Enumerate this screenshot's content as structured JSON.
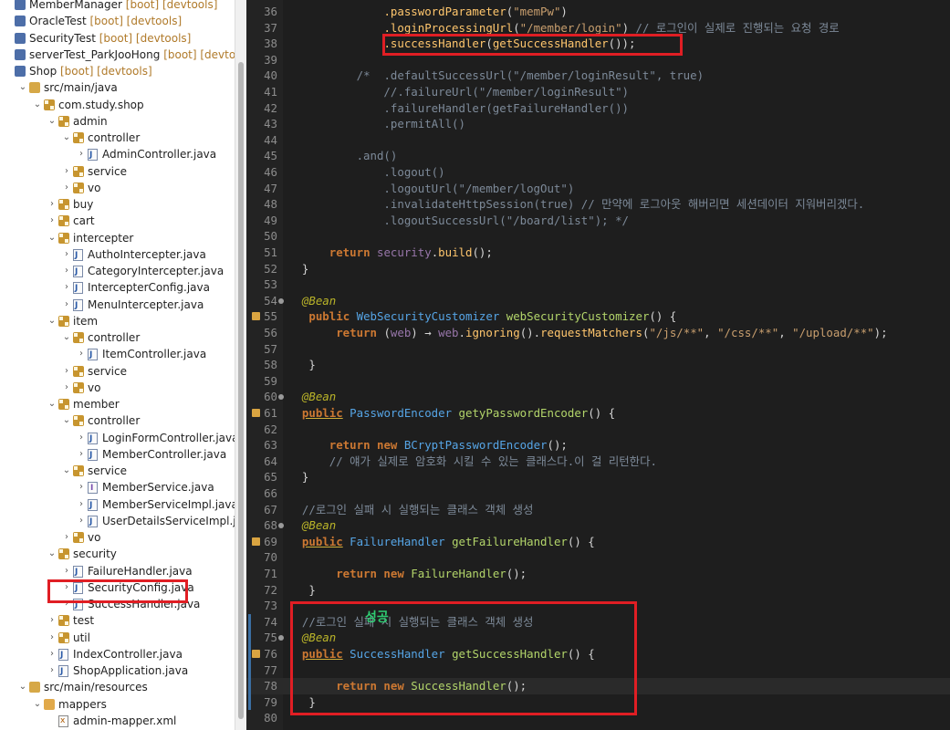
{
  "explorer": {
    "rows": [
      {
        "name": "MemberManager",
        "tag": " [boot] [devtools]",
        "indent": 0,
        "chev": "",
        "icon": "proj-ico"
      },
      {
        "name": "OracleTest",
        "tag": " [boot] [devtools]",
        "indent": 0,
        "chev": "",
        "icon": "proj-ico"
      },
      {
        "name": "SecurityTest",
        "tag": " [boot] [devtools]",
        "indent": 0,
        "chev": "",
        "icon": "proj-ico"
      },
      {
        "name": "serverTest_ParkJooHong",
        "tag": " [boot] [devtools]",
        "indent": 0,
        "chev": "",
        "icon": "proj-ico"
      },
      {
        "name": "Shop",
        "tag": " [boot] [devtools]",
        "indent": 0,
        "chev": "",
        "icon": "proj-ico"
      },
      {
        "name": "src/main/java",
        "tag": "",
        "indent": 1,
        "chev": "⌄",
        "icon": "src-ico"
      },
      {
        "name": "com.study.shop",
        "tag": "",
        "indent": 2,
        "chev": "⌄",
        "icon": "pkg-ico"
      },
      {
        "name": "admin",
        "tag": "",
        "indent": 3,
        "chev": "⌄",
        "icon": "pkg-ico"
      },
      {
        "name": "controller",
        "tag": "",
        "indent": 4,
        "chev": "⌄",
        "icon": "pkg-ico"
      },
      {
        "name": "AdminController.java",
        "tag": "",
        "indent": 5,
        "chev": "›",
        "icon": "jfile-ico"
      },
      {
        "name": "service",
        "tag": "",
        "indent": 4,
        "chev": "›",
        "icon": "pkg-ico"
      },
      {
        "name": "vo",
        "tag": "",
        "indent": 4,
        "chev": "›",
        "icon": "pkg-ico"
      },
      {
        "name": "buy",
        "tag": "",
        "indent": 3,
        "chev": "›",
        "icon": "pkg-ico"
      },
      {
        "name": "cart",
        "tag": "",
        "indent": 3,
        "chev": "›",
        "icon": "pkg-ico"
      },
      {
        "name": "intercepter",
        "tag": "",
        "indent": 3,
        "chev": "⌄",
        "icon": "pkg-ico"
      },
      {
        "name": "AuthoIntercepter.java",
        "tag": "",
        "indent": 4,
        "chev": "›",
        "icon": "jfile-ico"
      },
      {
        "name": "CategoryIntercepter.java",
        "tag": "",
        "indent": 4,
        "chev": "›",
        "icon": "jfile-ico"
      },
      {
        "name": "IntercepterConfig.java",
        "tag": "",
        "indent": 4,
        "chev": "›",
        "icon": "jfile-ico"
      },
      {
        "name": "MenuIntercepter.java",
        "tag": "",
        "indent": 4,
        "chev": "›",
        "icon": "jfile-ico"
      },
      {
        "name": "item",
        "tag": "",
        "indent": 3,
        "chev": "⌄",
        "icon": "pkg-ico"
      },
      {
        "name": "controller",
        "tag": "",
        "indent": 4,
        "chev": "⌄",
        "icon": "pkg-ico"
      },
      {
        "name": "ItemController.java",
        "tag": "",
        "indent": 5,
        "chev": "›",
        "icon": "jfile-ico"
      },
      {
        "name": "service",
        "tag": "",
        "indent": 4,
        "chev": "›",
        "icon": "pkg-ico"
      },
      {
        "name": "vo",
        "tag": "",
        "indent": 4,
        "chev": "›",
        "icon": "pkg-ico"
      },
      {
        "name": "member",
        "tag": "",
        "indent": 3,
        "chev": "⌄",
        "icon": "pkg-ico"
      },
      {
        "name": "controller",
        "tag": "",
        "indent": 4,
        "chev": "⌄",
        "icon": "pkg-ico"
      },
      {
        "name": "LoginFormController.java",
        "tag": "",
        "indent": 5,
        "chev": "›",
        "icon": "jfile-ico"
      },
      {
        "name": "MemberController.java",
        "tag": "",
        "indent": 5,
        "chev": "›",
        "icon": "jfile-ico"
      },
      {
        "name": "service",
        "tag": "",
        "indent": 4,
        "chev": "⌄",
        "icon": "pkg-ico"
      },
      {
        "name": "MemberService.java",
        "tag": "",
        "indent": 5,
        "chev": "›",
        "icon": "ifile-ico"
      },
      {
        "name": "MemberServiceImpl.java",
        "tag": "",
        "indent": 5,
        "chev": "›",
        "icon": "jfile-ico"
      },
      {
        "name": "UserDetailsServiceImpl.java",
        "tag": "",
        "indent": 5,
        "chev": "›",
        "icon": "jfile-ico"
      },
      {
        "name": "vo",
        "tag": "",
        "indent": 4,
        "chev": "›",
        "icon": "pkg-ico"
      },
      {
        "name": "security",
        "tag": "",
        "indent": 3,
        "chev": "⌄",
        "icon": "pkg-ico"
      },
      {
        "name": "FailureHandler.java",
        "tag": "",
        "indent": 4,
        "chev": "›",
        "icon": "jfile-ico"
      },
      {
        "name": "SecurityConfig.java",
        "tag": "",
        "indent": 4,
        "chev": "›",
        "icon": "jfile-ico"
      },
      {
        "name": "SuccessHandler.java",
        "tag": "",
        "indent": 4,
        "chev": "›",
        "icon": "jfile-ico"
      },
      {
        "name": "test",
        "tag": "",
        "indent": 3,
        "chev": "›",
        "icon": "pkg-ico"
      },
      {
        "name": "util",
        "tag": "",
        "indent": 3,
        "chev": "›",
        "icon": "pkg-ico"
      },
      {
        "name": "IndexController.java",
        "tag": "",
        "indent": 3,
        "chev": "›",
        "icon": "jfile-ico"
      },
      {
        "name": "ShopApplication.java",
        "tag": "",
        "indent": 3,
        "chev": "›",
        "icon": "jfile-ico"
      },
      {
        "name": "src/main/resources",
        "tag": "",
        "indent": 1,
        "chev": "⌄",
        "icon": "src-ico"
      },
      {
        "name": "mappers",
        "tag": "",
        "indent": 2,
        "chev": "⌄",
        "icon": "folder-ico"
      },
      {
        "name": "admin-mapper.xml",
        "tag": "",
        "indent": 3,
        "chev": "",
        "icon": "xml-ico"
      }
    ],
    "highlighted_file": "SecurityConfig.java"
  },
  "editor": {
    "lines": [
      {
        "n": "36",
        "code": "              <span class='m'>.passwordParameter</span>(<span class='s'>\"memPw\"</span>)"
      },
      {
        "n": "37",
        "code": "              <span class='m'>.loginProcessingUrl</span>(<span class='s'>\"/member/login\"</span>) <span class='c'>// 로그인이 실제로 진행되는 요청 경로</span>"
      },
      {
        "n": "38",
        "code": "              <span class='m'>.successHandler</span>(<span class='m'>getSuccessHandler</span>());"
      },
      {
        "n": "39",
        "code": ""
      },
      {
        "n": "40",
        "code": "          <span class='c'>/*  .defaultSuccessUrl(\"/member/loginResult\", true)</span>"
      },
      {
        "n": "41",
        "code": "<span class='c'>              //.failureUrl(\"/member/loginResult\")</span>"
      },
      {
        "n": "42",
        "code": "<span class='c'>              .failureHandler(getFailureHandler())</span>"
      },
      {
        "n": "43",
        "code": "<span class='c'>              .permitAll()</span>"
      },
      {
        "n": "44",
        "code": ""
      },
      {
        "n": "45",
        "code": "<span class='c'>          .and()</span>"
      },
      {
        "n": "46",
        "code": "<span class='c'>              .logout()</span>"
      },
      {
        "n": "47",
        "code": "<span class='c'>              .logoutUrl(\"/member/logOut\")</span>"
      },
      {
        "n": "48",
        "code": "<span class='c'>              .invalidateHttpSession(true) // 만약에 로그아웃 해버리면 세션데이터 지워버리겠다.</span>"
      },
      {
        "n": "49",
        "code": "<span class='c'>              .logoutSuccessUrl(\"/board/list\"); */</span>"
      },
      {
        "n": "50",
        "code": ""
      },
      {
        "n": "51",
        "code": "      <span class='k'>return</span> <span class='v'>security</span>.<span class='m'>build</span>();"
      },
      {
        "n": "52",
        "code": "  }"
      },
      {
        "n": "53",
        "code": ""
      },
      {
        "n": "54",
        "code": "  <span class='a'>@Bean</span>"
      },
      {
        "n": "55",
        "code": "   <span class='k'>public</span> <span class='t'>WebSecurityCustomizer</span> <span class='mg'>webSecurityCustomizer</span>() {"
      },
      {
        "n": "56",
        "code": "       <span class='k'>return</span> (<span class='v'>web</span>) → <span class='v'>web</span>.<span class='m'>ignoring</span>().<span class='m'>requestMatchers</span>(<span class='s'>\"/js/**\"</span>, <span class='s'>\"/css/**\"</span>, <span class='s'>\"/upload/**\"</span>);"
      },
      {
        "n": "57",
        "code": ""
      },
      {
        "n": "58",
        "code": "   }"
      },
      {
        "n": "59",
        "code": ""
      },
      {
        "n": "60",
        "code": "  <span class='a'>@Bean</span>"
      },
      {
        "n": "61",
        "code": "  <span class='k ul'>public</span> <span class='t'>PasswordEncoder</span> <span class='mg'>getyPasswordEncoder</span>() {"
      },
      {
        "n": "62",
        "code": ""
      },
      {
        "n": "63",
        "code": "      <span class='k'>return new</span> <span class='t'>BCryptPasswordEncoder</span>();"
      },
      {
        "n": "64",
        "code": "      <span class='c'>// 얘가 실제로 암호화 시킬 수 있는 클래스다.이 걸 리턴한다.</span>"
      },
      {
        "n": "65",
        "code": "  }"
      },
      {
        "n": "66",
        "code": ""
      },
      {
        "n": "67",
        "code": "  <span class='c'>//로그인 실패 시 실행되는 클래스 객체 생성</span>"
      },
      {
        "n": "68",
        "code": "  <span class='a'>@Bean</span>"
      },
      {
        "n": "69",
        "code": "  <span class='k ul'>public</span> <span class='t'>FailureHandler</span> <span class='mg'>getFailureHandler</span>() {"
      },
      {
        "n": "70",
        "code": ""
      },
      {
        "n": "71",
        "code": "       <span class='k'>return new</span> <span class='mg'>FailureHandler</span>();"
      },
      {
        "n": "72",
        "code": "   }"
      },
      {
        "n": "73",
        "code": ""
      },
      {
        "n": "74",
        "code": "  <span class='c'>//로그인 실패 시 실행되는 클래스 객체 생성</span>"
      },
      {
        "n": "75",
        "code": "  <span class='a'>@Bean</span>"
      },
      {
        "n": "76",
        "code": "  <span class='k ul'>public</span> <span class='t'>SuccessHandler</span> <span class='mg'>getSuccessHandler</span>() {"
      },
      {
        "n": "77",
        "code": ""
      },
      {
        "n": "78",
        "code": "       <span class='k'>return new</span> <span class='mg'>SuccessHandler</span>();"
      },
      {
        "n": "79",
        "code": "   }"
      },
      {
        "n": "80",
        "code": ""
      }
    ],
    "fold_lines": [
      "54",
      "60",
      "68",
      "75"
    ],
    "warn_lines": [
      "55",
      "61",
      "69",
      "76"
    ],
    "changed_lines": [
      "74",
      "75",
      "76",
      "77",
      "78",
      "79"
    ],
    "current_line": "78",
    "annotation_text": "성공"
  }
}
